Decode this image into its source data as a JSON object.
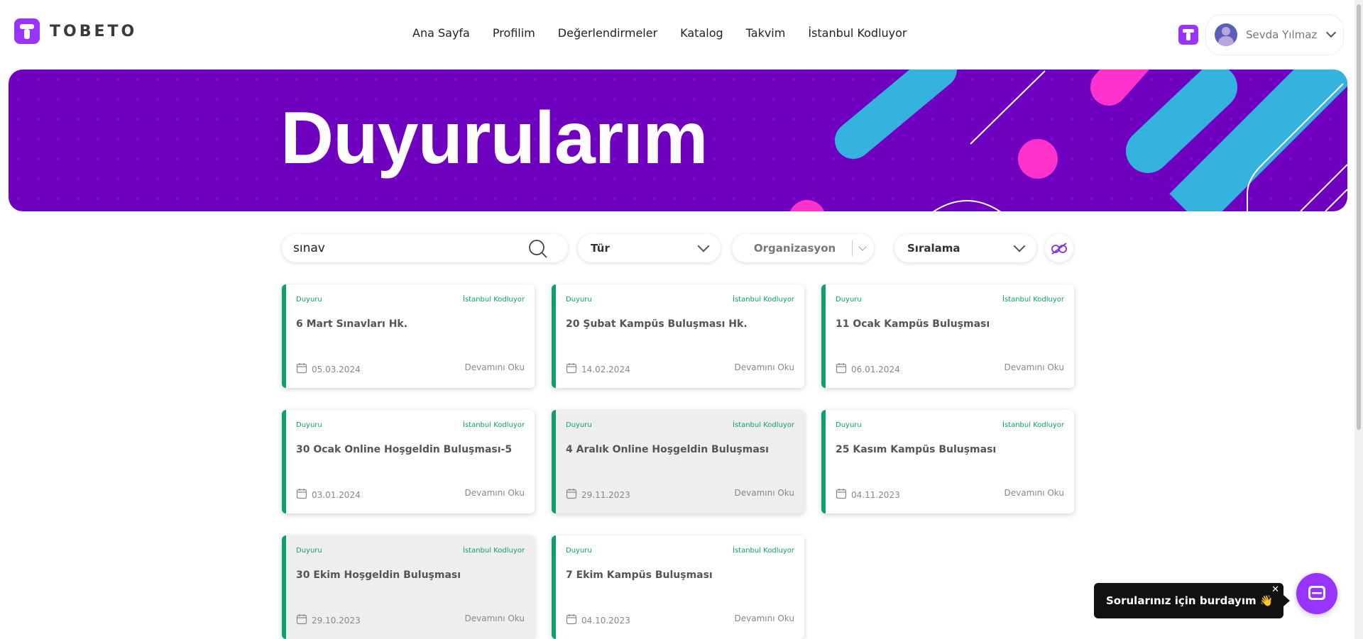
{
  "brand": {
    "name": "TOBETO"
  },
  "nav": {
    "links": [
      "Ana Sayfa",
      "Profilim",
      "Değerlendirmeler",
      "Katalog",
      "Takvim",
      "İstanbul Kodluyor"
    ],
    "user_name": "Sevda Yılmaz"
  },
  "banner": {
    "title": "Duyurularım"
  },
  "filters": {
    "search_value": "sınav",
    "type_label": "Tür",
    "org_label": "Organizasyon",
    "sort_label": "Sıralama"
  },
  "colors": {
    "accent": "#9933ff",
    "banner": "#7000c0",
    "card_border": "#0e9f6e"
  },
  "cards": [
    {
      "type": "Duyuru",
      "org": "İstanbul Kodluyor",
      "title": "6 Mart Sınavları Hk.",
      "date": "05.03.2024",
      "read": "Devamını Oku"
    },
    {
      "type": "Duyuru",
      "org": "İstanbul Kodluyor",
      "title": "20 Şubat Kampüs Buluşması Hk.",
      "date": "14.02.2024",
      "read": "Devamını Oku"
    },
    {
      "type": "Duyuru",
      "org": "İstanbul Kodluyor",
      "title": "11 Ocak Kampüs Buluşması",
      "date": "06.01.2024",
      "read": "Devamını Oku"
    },
    {
      "type": "Duyuru",
      "org": "İstanbul Kodluyor",
      "title": "30 Ocak Online Hoşgeldin Buluşması-5",
      "date": "03.01.2024",
      "read": "Devamını Oku"
    },
    {
      "type": "Duyuru",
      "org": "İstanbul Kodluyor",
      "title": "4 Aralık Online Hoşgeldin Buluşması",
      "date": "29.11.2023",
      "read": "Devamını Oku"
    },
    {
      "type": "Duyuru",
      "org": "İstanbul Kodluyor",
      "title": "25 Kasım Kampüs Buluşması",
      "date": "04.11.2023",
      "read": "Devamını Oku"
    },
    {
      "type": "Duyuru",
      "org": "İstanbul Kodluyor",
      "title": "30 Ekim Hoşgeldin Buluşması",
      "date": "29.10.2023",
      "read": "Devamını Oku"
    },
    {
      "type": "Duyuru",
      "org": "İstanbul Kodluyor",
      "title": "7 Ekim Kampüs Buluşması",
      "date": "04.10.2023",
      "read": "Devamını Oku"
    }
  ],
  "chat": {
    "tooltip": "Sorularınız için burdayım 👋",
    "close": "✕"
  }
}
